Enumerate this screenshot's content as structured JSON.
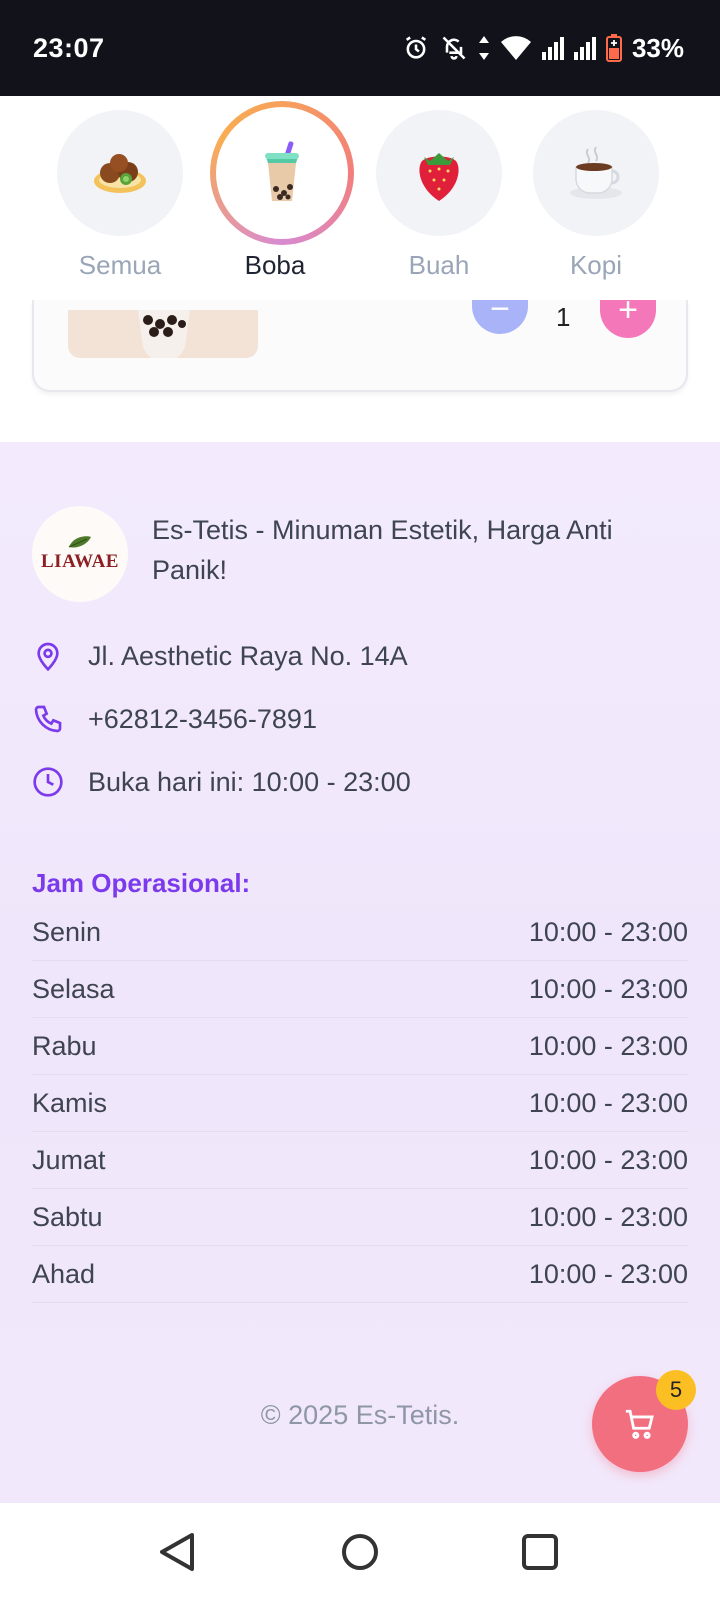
{
  "status_bar": {
    "time": "23:07",
    "battery_percent": "33%",
    "icons": [
      "alarm-icon",
      "bell-off-icon",
      "data-arrows-icon",
      "wifi-icon",
      "signal-icon",
      "signal-icon",
      "battery-icon"
    ]
  },
  "categories": [
    {
      "label": "Semua",
      "icon": "falafel-emoji",
      "active": false
    },
    {
      "label": "Boba",
      "icon": "bubble-tea-emoji",
      "active": true
    },
    {
      "label": "Buah",
      "icon": "strawberry-emoji",
      "active": false
    },
    {
      "label": "Kopi",
      "icon": "coffee-emoji",
      "active": false
    }
  ],
  "cart_item": {
    "quantity": "1",
    "minus_label": "−",
    "plus_label": "+"
  },
  "brand": {
    "logo_text": "LIAWAE",
    "tagline": "Es-Tetis - Minuman Estetik, Harga Anti Panik!"
  },
  "contact": {
    "address": "Jl. Aesthetic Raya No. 14A",
    "phone": "+62812-3456-7891",
    "today_hours": "Buka hari ini: 10:00 - 23:00"
  },
  "hours": {
    "title": "Jam Operasional:",
    "rows": [
      {
        "day": "Senin",
        "time": "10:00 - 23:00"
      },
      {
        "day": "Selasa",
        "time": "10:00 - 23:00"
      },
      {
        "day": "Rabu",
        "time": "10:00 - 23:00"
      },
      {
        "day": "Kamis",
        "time": "10:00 - 23:00"
      },
      {
        "day": "Jumat",
        "time": "10:00 - 23:00"
      },
      {
        "day": "Sabtu",
        "time": "10:00 - 23:00"
      },
      {
        "day": "Ahad",
        "time": "10:00 - 23:00"
      }
    ]
  },
  "footer": {
    "copyright": "© 2025 Es-Tetis."
  },
  "cart": {
    "badge_count": "5"
  },
  "colors": {
    "accent": "#7c3aed",
    "cart": "#f26f80",
    "badge": "#fbbf24"
  }
}
